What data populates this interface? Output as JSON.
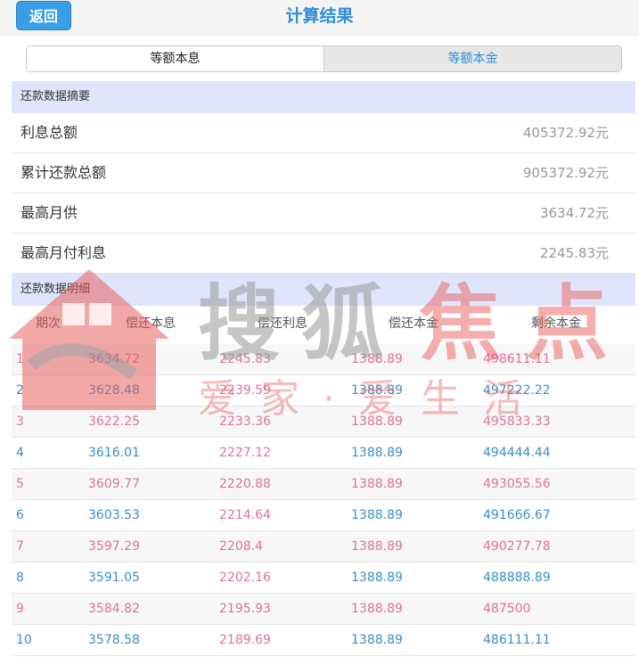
{
  "header": {
    "back_label": "返回",
    "title": "计算结果"
  },
  "tabs": [
    {
      "label": "等额本息",
      "active": false
    },
    {
      "label": "等额本金",
      "active": true
    }
  ],
  "summary": {
    "title": "还款数据摘要",
    "rows": [
      {
        "label": "利息总额",
        "value": "405372.92元"
      },
      {
        "label": "累计还款总额",
        "value": "905372.92元"
      },
      {
        "label": "最高月供",
        "value": "3634.72元"
      },
      {
        "label": "最高月付利息",
        "value": "2245.83元"
      }
    ]
  },
  "detail": {
    "title": "还款数据明细",
    "columns": [
      "期次",
      "偿还本息",
      "偿还利息",
      "偿还本金",
      "剩余本金"
    ],
    "rows": [
      [
        "1",
        "3634.72",
        "2245.83",
        "1388.89",
        "498611.11"
      ],
      [
        "2",
        "3628.48",
        "2239.59",
        "1388.89",
        "497222.22"
      ],
      [
        "3",
        "3622.25",
        "2233.36",
        "1388.89",
        "495833.33"
      ],
      [
        "4",
        "3616.01",
        "2227.12",
        "1388.89",
        "494444.44"
      ],
      [
        "5",
        "3609.77",
        "2220.88",
        "1388.89",
        "493055.56"
      ],
      [
        "6",
        "3603.53",
        "2214.64",
        "1388.89",
        "491666.67"
      ],
      [
        "7",
        "3597.29",
        "2208.4",
        "1388.89",
        "490277.78"
      ],
      [
        "8",
        "3591.05",
        "2202.16",
        "1388.89",
        "488888.89"
      ],
      [
        "9",
        "3584.82",
        "2195.93",
        "1388.89",
        "487500"
      ],
      [
        "10",
        "3578.58",
        "2189.69",
        "1388.89",
        "486111.11"
      ]
    ]
  },
  "watermark": {
    "brand": "搜狐焦点",
    "slogan": "爱家·爱生活"
  },
  "colors": {
    "accent_blue": "#2f8fd8",
    "row_pink": "#e0719a",
    "row_blue": "#3a8fc8",
    "interest_color": "#e0719a",
    "section_bg": "#dfe6fb",
    "watermark_red": "#e85a5a",
    "watermark_gray": "#9a9a9a"
  }
}
